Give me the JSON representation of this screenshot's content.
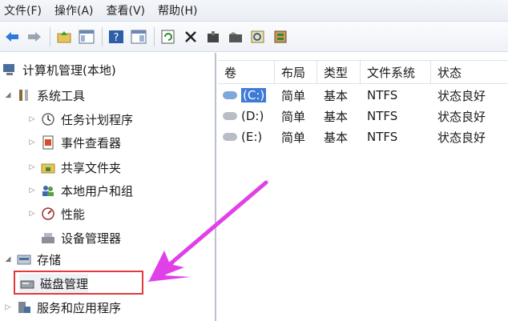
{
  "menu": [
    "文件(F)",
    "操作(A)",
    "查看(V)",
    "帮助(H)"
  ],
  "toolbar": {
    "buttons": [
      "back-arrow-icon",
      "forward-arrow-icon",
      "up-folder-icon",
      "show-hide-tree-icon",
      "help-icon",
      "console-view-icon",
      "refresh-icon",
      "delete-icon",
      "properties-icon",
      "open-icon",
      "search-icon",
      "settings-icon"
    ]
  },
  "tree": {
    "root": "计算机管理(本地)",
    "system_tools": "系统工具",
    "task_scheduler": "任务计划程序",
    "event_viewer": "事件查看器",
    "shared_folders": "共享文件夹",
    "local_users": "本地用户和组",
    "performance": "性能",
    "device_manager": "设备管理器",
    "storage": "存储",
    "disk_management": "磁盘管理",
    "services_apps": "服务和应用程序"
  },
  "table": {
    "columns": [
      "卷",
      "布局",
      "类型",
      "文件系统",
      "状态"
    ],
    "rows": [
      {
        "volume": "(C:)",
        "layout": "简单",
        "type": "基本",
        "fs": "NTFS",
        "status": "状态良好"
      },
      {
        "volume": "(D:)",
        "layout": "简单",
        "type": "基本",
        "fs": "NTFS",
        "status": "状态良好"
      },
      {
        "volume": "(E:)",
        "layout": "简单",
        "type": "基本",
        "fs": "NTFS",
        "status": "状态良好"
      }
    ]
  },
  "colors": {
    "selection": "#3d7bd6",
    "highlight_box": "#e23a3a",
    "arrow": "#e040e8"
  }
}
